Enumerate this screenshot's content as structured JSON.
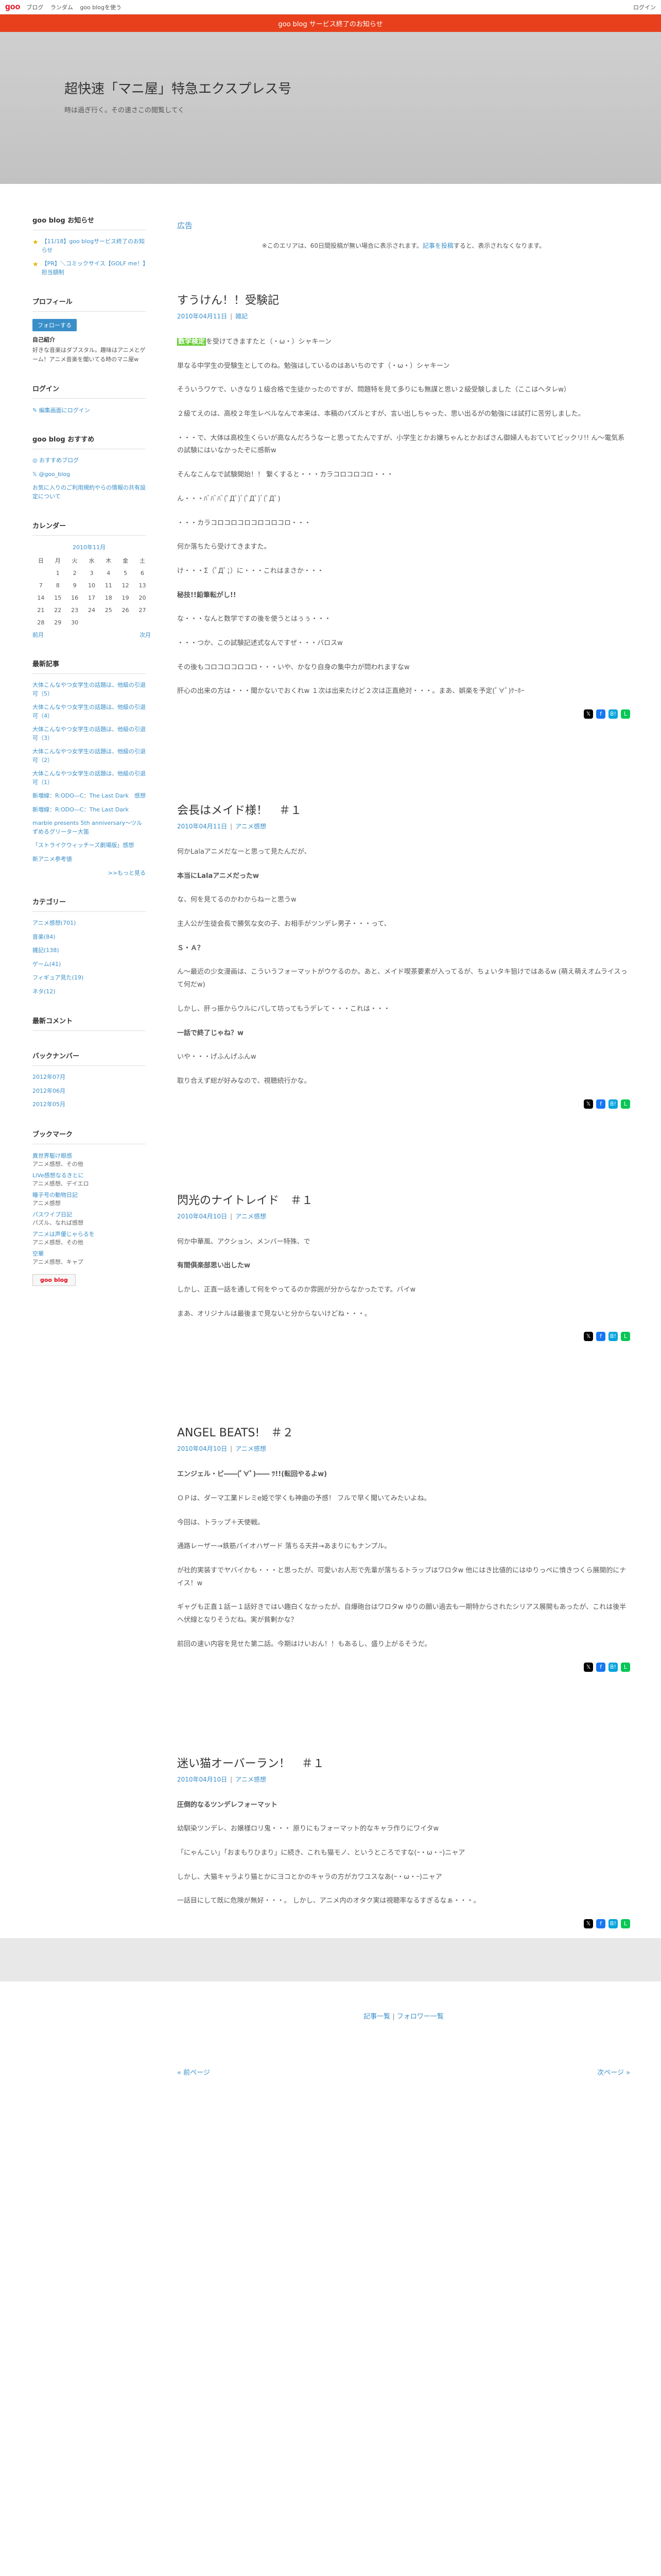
{
  "topbar": {
    "logo": "goo",
    "nav": [
      "ブログ",
      "ランダム",
      "goo blogを使う"
    ],
    "login": "ログイン"
  },
  "notice_bar": "goo blog サービス終了のお知らせ",
  "blog": {
    "title": "超快速「マニ屋」特急エクスプレス号",
    "subtitle": "時は過ぎ行く。その速さこの閲覧してく"
  },
  "sidebar": {
    "goo_notice_title": "goo blog お知らせ",
    "goo_notices": [
      "【11/18】goo blogサービス終了のお知らせ",
      "【PR】＼コミックサイス【GOLF me！】担当額制"
    ],
    "profile_title": "プロフィール",
    "follow_label": "フォローする",
    "profile_heading": "自己紹介",
    "profile_text": "好きな音楽はダブスタル。趣味はアニメとゲーム！アニメ音楽を聞いてる時のマニ屋w",
    "login_title": "ログイン",
    "login_link": "編集画面にログイン",
    "recommend_title": "goo blog おすすめ",
    "recommend_links": [
      "おすすめブログ",
      "@goo_blog"
    ],
    "recommend_text": "お気に入りのご利用規約やらの情報の共有設定について",
    "calendar_title": "カレンダー",
    "calendar_month": "2010年11月",
    "calendar_days": [
      "日",
      "月",
      "火",
      "水",
      "木",
      "金",
      "土"
    ],
    "calendar_weeks": [
      [
        "",
        "1",
        "2",
        "3",
        "4",
        "5",
        "6"
      ],
      [
        "7",
        "8",
        "9",
        "10",
        "11",
        "12",
        "13"
      ],
      [
        "14",
        "15",
        "16",
        "17",
        "18",
        "19",
        "20"
      ],
      [
        "21",
        "22",
        "23",
        "24",
        "25",
        "26",
        "27"
      ],
      [
        "28",
        "29",
        "30",
        "",
        "",
        "",
        ""
      ]
    ],
    "calendar_prev": "前月",
    "calendar_next": "次月",
    "recent_title": "最新記事",
    "recent_posts": [
      "大体こんなやつ女学生の話題は、他級の引退可（5）",
      "大体こんなやつ女学生の話題は、他級の引退可（4）",
      "大体こんなやつ女学生の話題は、他級の引退可（3）",
      "大体こんなやつ女学生の話題は、他級の引退可（2）",
      "大体こんなやつ女学生の話題は、他級の引退可（1）",
      "新増線：R:ODO―C：The Last Dark　感想",
      "新増線：R:ODO―C：The Last Dark",
      "marble presents 5th anniversary〜ツルずめるグリーター大笛",
      "「ストライクウィッチーズ劇場版」感想",
      "新アニメ参考値"
    ],
    "recent_more": ">>もっと見る",
    "category_title": "カテゴリー",
    "categories": [
      "アニメ感想(701)",
      "音楽(84)",
      "雑記(138)",
      "ゲーム(41)",
      "フィギュア見た(19)",
      "ネタ(12)"
    ],
    "comments_title": "最新コメント",
    "backnumber_title": "バックナンバー",
    "backnumbers": [
      "2012年07月",
      "2012年06月",
      "2012年05月"
    ],
    "bookmark_title": "ブックマーク",
    "bookmarks": [
      {
        "title": "異世界駆け眼感",
        "desc": "アニメ感想、その他"
      },
      {
        "title": "LiVe感想なるきとに",
        "desc": "アニメ感想、デイエロ"
      },
      {
        "title": "瞳子号の動物日記",
        "desc": "アニメ感想"
      },
      {
        "title": "パスワイプ日記",
        "desc": "パズル、なれば感想"
      },
      {
        "title": "アニメは声優じゃらるを",
        "desc": "アニメ感想、その他"
      },
      {
        "title": "空華",
        "desc": "アニメ感想、キャプ"
      }
    ],
    "goo_badge": "goo blog"
  },
  "main": {
    "ad_label": "広告",
    "ad_text_pre": "※このエリアは、60日間投稿が無い場合に表示されます。",
    "ad_text_link": "記事を投稿",
    "ad_text_post": "すると、表示されなくなります。",
    "entries": [
      {
        "title": "すうけん！！受験記",
        "date": "2010年04月11日",
        "category": "雑記",
        "paragraphs": [
          {
            "type": "text",
            "pre_hl": "数学検定",
            "text": "を受けてきますたと（・ω・）シャキーン"
          },
          {
            "type": "text",
            "text": "単なる中学生の受験生としてのね。勉強はしているのはあいちのです（・ω・）シャキーン"
          },
          {
            "type": "text",
            "text": "そういうワケで、いきなり１級合格で生徒かったのですが、問題特を見て多りにも無謀と思い２級受験しました（ここはヘタレw）"
          },
          {
            "type": "text",
            "text": "２級てえのは、高校２年生レベルなんで本来は、本稿のパズルとすが、言い出しちゃった、思い出るがの勉強には試打に苦労しました。"
          },
          {
            "type": "text",
            "text": "・・・で、大体は高校生くらいが高なんだろうなーと思ってたんですが、小学生とかお嬢ちゃんとかおばさん御婦人もおていてビックリ!! ん〜電気系の試験にはいなかったぞに感新w"
          },
          {
            "type": "text",
            "text": "そんなこんなで試験開始！！ 繋くすると・・・カラコロコロコロ・・・"
          },
          {
            "type": "text",
            "text": "ん・・・ﾊﾞﾊﾞﾊﾞ(ﾟДﾟ)ﾞ(ﾟДﾟ)ﾞ(ﾟДﾟ)"
          },
          {
            "type": "text",
            "text": "・・・カラコロコロコロコロコロコロ・・・"
          },
          {
            "type": "text",
            "text": "何か落ちたら受けてきますた。"
          },
          {
            "type": "text",
            "text": "け・・・Σ（ﾟДﾟ；）に・・・これはまさか・・・"
          },
          {
            "type": "bigred",
            "text": "秘技!!鉛筆転がし!!"
          },
          {
            "type": "text",
            "text": "な・・・なんと数学ですの後を使うとはぅぅ・・・"
          },
          {
            "type": "text",
            "text": "・・・つか、この試験記述式なんですぜ・・・バロスw"
          },
          {
            "type": "text",
            "text": "その後もコロコロコロコロ・・・いや、かなり自身の集中力が問われますなw"
          },
          {
            "type": "text",
            "text": "肝心の出来の方は・・・聞かないでおくれw １次は出来たけど２次は正直絶対・・・。まあ、娯楽を予定(ﾟ∀ﾟ)ｹｰﾎｰ"
          }
        ]
      },
      {
        "title": "会長はメイド様！　＃１",
        "date": "2010年04月11日",
        "category": "アニメ感想",
        "paragraphs": [
          {
            "type": "text",
            "text": "何かLalaアニメだなーと思って見たんだが、"
          },
          {
            "type": "bigblue",
            "text": "本当にLalaアニメだったw"
          },
          {
            "type": "text",
            "text": "な、何を見てるのかわからねーと思うw"
          },
          {
            "type": "text",
            "text": "主人公が生徒会長で勝気な女の子、お相手がツンデレ男子・・・って、"
          },
          {
            "type": "bigred",
            "text": "Ｓ・Ａ？"
          },
          {
            "type": "text",
            "text": "ん〜最近の少女漫画は、こういうフォーマットがウケるのか。あと、メイド喫茶要素が入ってるが、ちょいタキ狙けではあるw (萌え萌えオムライスって何だw)"
          },
          {
            "type": "text",
            "text": "しかし、肝っ振からウルにパして坊ってもうデレて・・・これは・・・"
          },
          {
            "type": "bigblack",
            "text": "一話で終了じゃね？w"
          },
          {
            "type": "text",
            "text": "いや・・・げふんげふんw"
          },
          {
            "type": "text",
            "text": "取り合えず総が好みなので、視聴続行かな。"
          }
        ]
      },
      {
        "title": "閃光のナイトレイド　＃１",
        "date": "2010年04月10日",
        "category": "アニメ感想",
        "paragraphs": [
          {
            "type": "text",
            "text": "何か中華風、アクション、メンバー特殊、で"
          },
          {
            "type": "bigblack",
            "text": "有間俱楽部思い出したw"
          },
          {
            "type": "text",
            "text": "しかし、正直一話を通して何をやってるのか雰囲が分からなかったです。バイw"
          },
          {
            "type": "text",
            "text": "まあ、オリジナルは最後まで見ないと分からないけどね・・・。"
          }
        ]
      },
      {
        "title": "ANGEL BEATS!　＃２",
        "date": "2010年04月10日",
        "category": "アニメ感想",
        "paragraphs": [
          {
            "type": "bigblack",
            "text": "エンジェル・ビ――(ﾟ∀ﾟ)―― ﾂ!!(転回やるよw)"
          },
          {
            "type": "text",
            "text": "ＯＰは、ダーマ工業ドレミe姫で学くも神曲の予感！ フルで早く聞いてみたいよね。"
          },
          {
            "type": "text",
            "text": "今回は、トラップ＋天使戦。"
          },
          {
            "type": "text",
            "text": "通路レーザー→鉄筋パイオハザード 落ちる天井→あまりにもナンプル。"
          },
          {
            "type": "text",
            "text": "が社的実装すでヤバイかも・・・と思ったが、可愛いお人形で先輩が落ちるトラップはワロタw 他にはき比値的にはゆりっぺに憤きつくら展開的にナイス！w"
          },
          {
            "type": "text",
            "text": "ギャグも正直１話ー１話好きではい趣白くなかったが、自爆砲台はワロタw ゆりの願い過去も一期特からされたシリアス展開もあったが、これは後半へ伏線となりそうだね。実が貧剰かな？"
          },
          {
            "type": "text",
            "text": "前回の速い内容を見せた第二話。今期はけいおん！！もあるし、盛り上がるそうだ。"
          }
        ]
      },
      {
        "title": "迷い猫オーバーラン！　＃１",
        "date": "2010年04月10日",
        "category": "アニメ感想",
        "paragraphs": [
          {
            "type": "bigblack",
            "text": "圧倒的なるツンデレフォーマット"
          },
          {
            "type": "text",
            "text": "幼馴染ツンデレ、お嬢様ロリ鬼・・・ 原りにもフォーマット的なキャラ作りにワイタw"
          },
          {
            "type": "text",
            "text": "「にゃんこい」「おまもりひまり」に続き、これも猫モノ、というところですな(ｰ・ω・ｰ)ニャア"
          },
          {
            "type": "text",
            "text": "しかし、大猫キャラより猫とかにヨコとかのキャラの方がカワユスなあ(ｰ・ω・ｰ)ニャア"
          },
          {
            "type": "text",
            "text": "一話目にして既に危険が無好・・・。 しかし、アニメ内のオタク実は視聴率なるすぎるなぁ・・・。"
          }
        ]
      }
    ],
    "footer_links": [
      "記事一覧",
      "フォロワー一覧"
    ],
    "prev_page": "« 前ページ",
    "next_page": "次ページ »"
  },
  "share_icons": [
    "x-icon",
    "facebook-icon",
    "hatena-icon",
    "line-icon"
  ]
}
